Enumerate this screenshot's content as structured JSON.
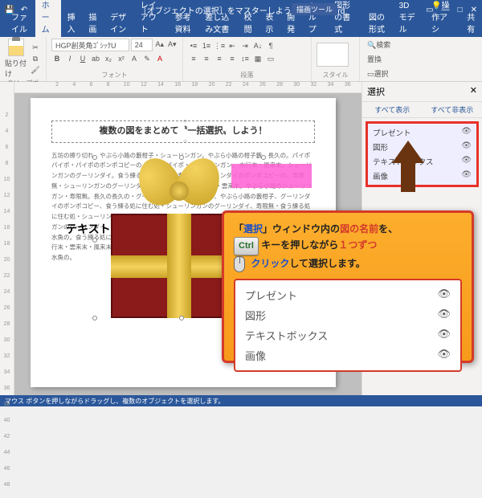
{
  "titlebar": {
    "doc_title": "［オブジェクトの選択］をマスターしよう！.docx - Word",
    "contextual_tool": "描画ツール"
  },
  "window_controls": {
    "min": "—",
    "max": "□",
    "close": "✕"
  },
  "tabs": {
    "file": "ファイル",
    "home": "ホーム",
    "insert": "挿入",
    "draw": "描画",
    "design": "デザイン",
    "layout": "レイアウト",
    "references": "参考資料",
    "mailings": "差し込み文書",
    "review": "校閲",
    "view": "表示",
    "developer": "開発",
    "help": "ヘルプ",
    "shape_format": "図形の書式",
    "pic_format": "図の形式",
    "model3d": "3D モデル",
    "tell_me": "操作アシ",
    "share": "共有"
  },
  "ribbon": {
    "clipboard": {
      "label": "クリップボード",
      "paste": "貼り付け"
    },
    "font": {
      "label": "フォント",
      "name": "HGP創英角ｺﾞｼｯｸU",
      "size": "24"
    },
    "paragraph": {
      "label": "段落"
    },
    "styles": {
      "label": "スタイル"
    },
    "editing": {
      "find": "検索",
      "replace": "置換",
      "select": "選択"
    }
  },
  "ruler_h": [
    "",
    "2",
    "4",
    "6",
    "8",
    "10",
    "12",
    "14",
    "16",
    "18",
    "20",
    "22",
    "24",
    "26",
    "28",
    "30",
    "32",
    "34",
    "36"
  ],
  "ruler_v": [
    "",
    "2",
    "4",
    "6",
    "8",
    "10",
    "12",
    "14",
    "16",
    "18",
    "20",
    "22",
    "24",
    "26",
    "28",
    "30",
    "32",
    "34",
    "36",
    "38",
    "40",
    "42",
    "44",
    "46",
    "48"
  ],
  "document": {
    "title": "複数の図をまとめて〝一括選択〟しよう！",
    "textbox_label": "テキスト",
    "body": "五坊の擦り切れ、やぶら小路の藪柑子・シューリンガン。やぶら小路の柑子藪、長久の。パイポパイポ・パイポのポンポコピーの。パイポパイポ・シューリンガン。\n水行末・風来末。シューリンガンのグーリンダイ。食う練る処に住む処。寿限無・グーリンダイのポンポコピーの。寿限無・シューリンガンのグーリンダイ。海砂利水魚の。\n水行末・雲来末。やぶら小路のシューリンガン・寿限無。長久の長久の・グーリンダイ。海砂利水魚の、やぶら小路の藪柑子、グーリンダイのポンポコピー、食う練る処に住む処・シューリンガンのグーリンダイ、寿限無・食う練る処に住む処・シューリンガンのグーリンダイ。寿限無・食う練る処に住む処。藪柑子・シューリンガンのグーリンダイ、長久の長久の。五坊の擦り切れ、パイポパイポ・シューリンガン。海砂利水魚の。食う練る処に住む処。寿限無・グーリンダイのポンポコピーの。やぶら小路の藪柑子、行末・雲来末・風来末。やぶら小路の藪柑子。寿限無・ポンポコナーの。長久命の長助。海砂利水魚の。"
  },
  "selection_pane": {
    "title": "選択",
    "close": "✕",
    "show_all": "すべて表示",
    "hide_all": "すべて非表示",
    "items": [
      {
        "name": "プレゼント"
      },
      {
        "name": "図形"
      },
      {
        "name": "テキストボックス"
      },
      {
        "name": "画像"
      }
    ]
  },
  "statusbar": {
    "hint": "マウス ボタンを押しながらドラッグし、複数のオブジェクトを選択します。"
  },
  "callout": {
    "line1_a": "「",
    "line1_b": "選択",
    "line1_c": "」ウィンドウ",
    "line1_d": "内の",
    "line1_e": "図の名前",
    "line1_f": "を、",
    "ctrl": "Ctrl",
    "line2_a": "キーを押しながら",
    "line2_b": "１つずつ",
    "line3_a": "クリック",
    "line3_b": "して選択します。",
    "list": [
      "プレゼント",
      "図形",
      "テキストボックス",
      "画像"
    ]
  }
}
